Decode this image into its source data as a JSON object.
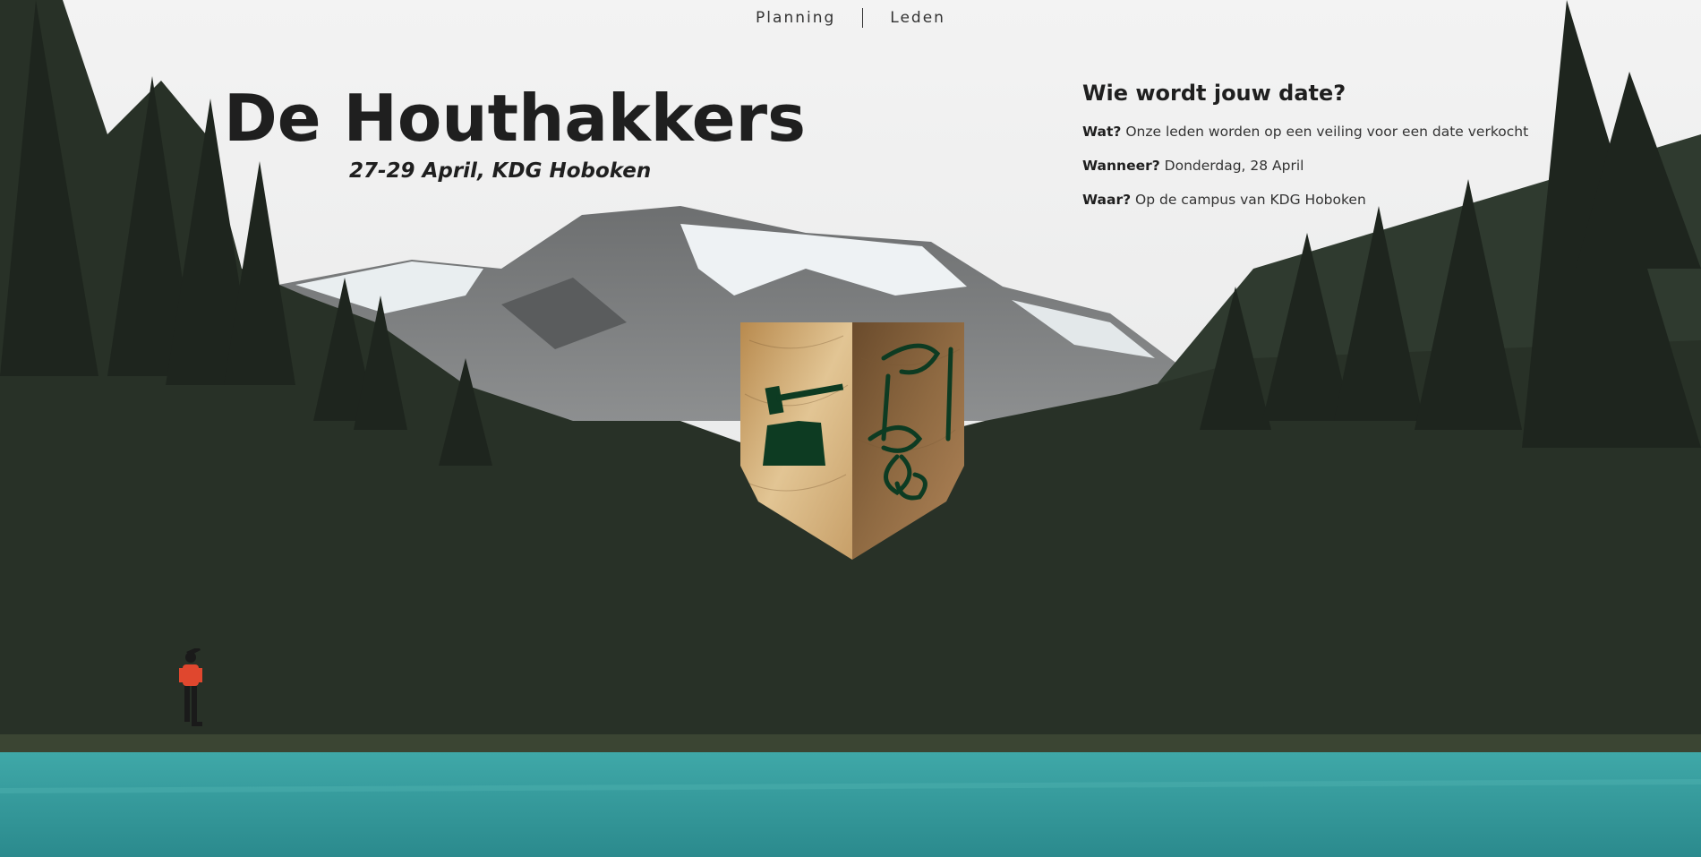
{
  "nav": {
    "items": [
      {
        "label": "Planning"
      },
      {
        "label": "Leden"
      }
    ]
  },
  "hero": {
    "title": "De Houthakkers",
    "subtitle": "27-29 April, KDG Hoboken"
  },
  "info": {
    "heading": "Wie wordt jouw date?",
    "rows": [
      {
        "label": "Wat?",
        "text": " Onze leden worden op een veiling voor een date verkocht"
      },
      {
        "label": "Wanneer?",
        "text": " Donderdag, 28 April"
      },
      {
        "label": "Waar?",
        "text": " Op de campus van KDG Hoboken"
      }
    ]
  },
  "icons": {
    "crest": "shield-crest-icon",
    "axe": "axe-in-stump-icon",
    "lumberjack": "lumberjack-figure-icon"
  },
  "colors": {
    "text_dark": "#1f1f1f",
    "lake": "#3a9ea0",
    "forest": "#2a3029",
    "crest_green": "#0d3b22",
    "lumberjack_red": "#e0472e"
  }
}
